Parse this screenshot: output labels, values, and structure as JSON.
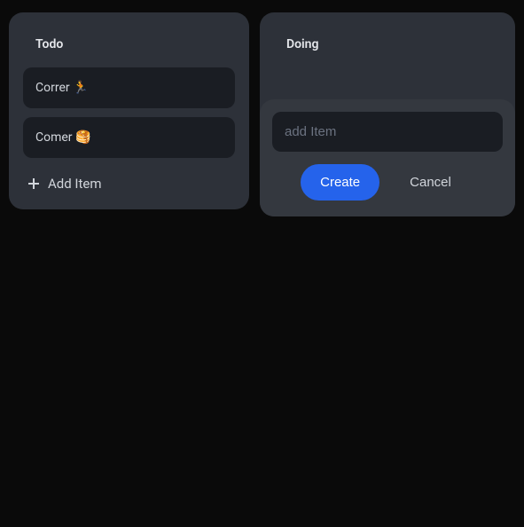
{
  "columns": {
    "todo": {
      "title": "Todo",
      "cards": [
        {
          "text": "Correr 🏃"
        },
        {
          "text": "Comer 🥞"
        }
      ],
      "add_label": "Add Item"
    },
    "doing": {
      "title": "Doing",
      "form": {
        "placeholder": "add Item",
        "value": "",
        "create_label": "Create",
        "cancel_label": "Cancel"
      }
    }
  }
}
